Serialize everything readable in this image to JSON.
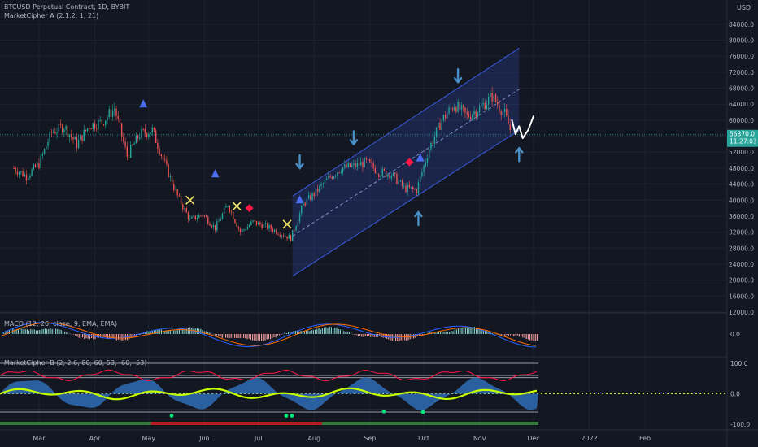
{
  "header": {
    "symbol_line": "BTCUSD Perpetual Contract, 1D, BYBIT",
    "indicator_a": "MarketCipher A (2.1.2, 1, 21)"
  },
  "indicators": {
    "macd_label": "MACD (12, 26, close, 9, EMA, EMA)",
    "mcb_label": "MarketCipher B (2, 2.6, 80, 60, 53, -60, -53)"
  },
  "price_axis": {
    "currency": "USD",
    "current_price": "56370.0",
    "countdown": "11:27:03"
  },
  "colors": {
    "background": "#131722",
    "bull": "#26a69a",
    "bear": "#ef5350",
    "channel": "#3b5bdb",
    "arrow": "#4a90c8",
    "price_badge": "#26a69a"
  },
  "chart_data": [
    {
      "type": "candlestick",
      "ylabel": "USD",
      "ylim": [
        12000,
        86000
      ],
      "y_ticks": [
        "84000.0",
        "80000.0",
        "76000.0",
        "72000.0",
        "68000.0",
        "64000.0",
        "60000.0",
        "56000.0",
        "52000.0",
        "48000.0",
        "44000.0",
        "40000.0",
        "36000.0",
        "32000.0",
        "28000.0",
        "24000.0",
        "20000.0",
        "16000.0",
        "12000.0"
      ],
      "x_ticks": [
        "Mar",
        "Apr",
        "May",
        "Jun",
        "Jul",
        "Aug",
        "Sep",
        "Oct",
        "Nov",
        "Dec",
        "2022",
        "Feb"
      ],
      "close_series": [
        {
          "date": "2021-02-15",
          "close": 48000
        },
        {
          "date": "2021-02-22",
          "close": 46000
        },
        {
          "date": "2021-03-01",
          "close": 49000
        },
        {
          "date": "2021-03-08",
          "close": 57000
        },
        {
          "date": "2021-03-15",
          "close": 58500
        },
        {
          "date": "2021-03-22",
          "close": 54000
        },
        {
          "date": "2021-03-29",
          "close": 58700
        },
        {
          "date": "2021-04-05",
          "close": 59500
        },
        {
          "date": "2021-04-12",
          "close": 63000
        },
        {
          "date": "2021-04-19",
          "close": 51000
        },
        {
          "date": "2021-04-26",
          "close": 56500
        },
        {
          "date": "2021-05-03",
          "close": 57500
        },
        {
          "date": "2021-05-10",
          "close": 49000
        },
        {
          "date": "2021-05-17",
          "close": 41000
        },
        {
          "date": "2021-05-24",
          "close": 35000
        },
        {
          "date": "2021-05-31",
          "close": 36500
        },
        {
          "date": "2021-06-07",
          "close": 33000
        },
        {
          "date": "2021-06-14",
          "close": 39000
        },
        {
          "date": "2021-06-21",
          "close": 32000
        },
        {
          "date": "2021-06-28",
          "close": 34500
        },
        {
          "date": "2021-07-05",
          "close": 33500
        },
        {
          "date": "2021-07-12",
          "close": 32000
        },
        {
          "date": "2021-07-19",
          "close": 30500
        },
        {
          "date": "2021-07-26",
          "close": 39000
        },
        {
          "date": "2021-08-02",
          "close": 42000
        },
        {
          "date": "2021-08-09",
          "close": 45500
        },
        {
          "date": "2021-08-16",
          "close": 48000
        },
        {
          "date": "2021-08-23",
          "close": 48500
        },
        {
          "date": "2021-08-30",
          "close": 49500
        },
        {
          "date": "2021-09-06",
          "close": 47000
        },
        {
          "date": "2021-09-13",
          "close": 46500
        },
        {
          "date": "2021-09-20",
          "close": 43000
        },
        {
          "date": "2021-09-27",
          "close": 42500
        },
        {
          "date": "2021-10-04",
          "close": 53000
        },
        {
          "date": "2021-10-11",
          "close": 60000
        },
        {
          "date": "2021-10-18",
          "close": 64000
        },
        {
          "date": "2021-10-25",
          "close": 61000
        },
        {
          "date": "2021-11-01",
          "close": 63000
        },
        {
          "date": "2021-11-08",
          "close": 66000
        },
        {
          "date": "2021-11-15",
          "close": 61500
        },
        {
          "date": "2021-11-19",
          "close": 56370
        }
      ],
      "channel": {
        "lower": [
          {
            "date": "2021-07-20",
            "price": 21000
          },
          {
            "date": "2021-11-23",
            "price": 57500
          }
        ],
        "upper": [
          {
            "date": "2021-07-20",
            "price": 41000
          },
          {
            "date": "2021-11-23",
            "price": 78000
          }
        ]
      },
      "projection": [
        {
          "date": "2021-11-19",
          "price": 60000
        },
        {
          "date": "2021-11-21",
          "price": 56500
        },
        {
          "date": "2021-11-23",
          "price": 58500
        },
        {
          "date": "2021-11-25",
          "price": 55500
        },
        {
          "date": "2021-11-28",
          "price": 57500
        },
        {
          "date": "2021-12-01",
          "price": 61000
        }
      ],
      "markers": [
        {
          "kind": "triangle-up",
          "date": "2021-04-28",
          "price": 64000
        },
        {
          "kind": "triangle-up",
          "date": "2021-06-07",
          "price": 46500
        },
        {
          "kind": "triangle-up",
          "date": "2021-07-24",
          "price": 40000
        },
        {
          "kind": "triangle-up",
          "date": "2021-09-29",
          "price": 50500
        },
        {
          "kind": "cross",
          "date": "2021-05-24",
          "price": 40000
        },
        {
          "kind": "cross",
          "date": "2021-06-19",
          "price": 38500
        },
        {
          "kind": "cross",
          "date": "2021-07-17",
          "price": 34000
        },
        {
          "kind": "diamond",
          "date": "2021-06-26",
          "price": 38000
        },
        {
          "kind": "diamond",
          "date": "2021-09-23",
          "price": 49500
        },
        {
          "kind": "arrow-down",
          "date": "2021-07-24",
          "price": 48000
        },
        {
          "kind": "arrow-down",
          "date": "2021-08-23",
          "price": 54000
        },
        {
          "kind": "arrow-down",
          "date": "2021-10-20",
          "price": 69500
        },
        {
          "kind": "arrow-up",
          "date": "2021-09-28",
          "price": 37000
        },
        {
          "kind": "arrow-up",
          "date": "2021-11-23",
          "price": 53000
        }
      ]
    },
    {
      "type": "bar",
      "name": "MACD",
      "ylim": [
        -1,
        1
      ],
      "y_ticks": [
        "0.0"
      ]
    },
    {
      "type": "area",
      "name": "MarketCipher B",
      "ylim": [
        -100,
        100
      ],
      "y_ticks": [
        "100.0",
        "0.0",
        "-100.0"
      ]
    }
  ]
}
